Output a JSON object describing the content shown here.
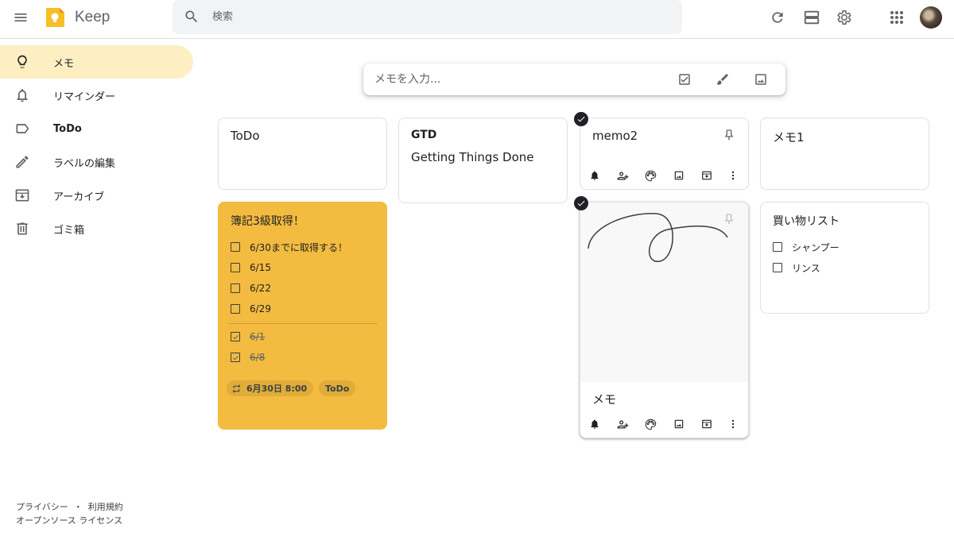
{
  "header": {
    "app_title": "Keep",
    "search_placeholder": "検索",
    "icons": [
      "menu-icon",
      "keep-logo",
      "search-icon",
      "refresh-icon",
      "list-view-icon",
      "settings-icon",
      "apps-grid-icon",
      "avatar"
    ]
  },
  "sidebar": {
    "items": [
      {
        "label": "メモ",
        "icon": "lightbulb-icon",
        "active": true
      },
      {
        "label": "リマインダー",
        "icon": "bell-icon"
      },
      {
        "label": "ToDo",
        "icon": "label-icon",
        "bold": true
      },
      {
        "label": "ラベルの編集",
        "icon": "pencil-icon"
      },
      {
        "label": "アーカイブ",
        "icon": "archive-icon"
      },
      {
        "label": "ゴミ箱",
        "icon": "trash-icon"
      }
    ]
  },
  "footer": {
    "privacy": "プライバシー",
    "separator": "・",
    "terms": "利用規約",
    "oss": "オープンソース ライセンス"
  },
  "take_note": {
    "placeholder": "メモを入力...",
    "icons": [
      "checkbox-icon",
      "brush-icon",
      "image-icon"
    ]
  },
  "notes": {
    "todo": {
      "title": "ToDo"
    },
    "gtd": {
      "title": "GTD",
      "text": "Getting Things Done"
    },
    "memo2": {
      "title": "memo2"
    },
    "memo1": {
      "title": "メモ1"
    },
    "boki": {
      "title": "簿記3級取得！",
      "color": "#f3bb3f",
      "unchecked": [
        "6/30までに取得する！",
        "6/15",
        "6/22",
        "6/29"
      ],
      "checked": [
        "6/1",
        "6/8"
      ],
      "reminder_chip": "6月30日 8:00",
      "label_chip": "ToDo"
    },
    "drawing": {
      "title": "メモ"
    },
    "shopping": {
      "title": "買い物リスト",
      "items": [
        "シャンプー",
        "リンス"
      ]
    }
  },
  "colors": {
    "active_nav": "#feefc3",
    "yellow_note": "#f3bb3f",
    "search_bg": "#f1f3f4"
  }
}
